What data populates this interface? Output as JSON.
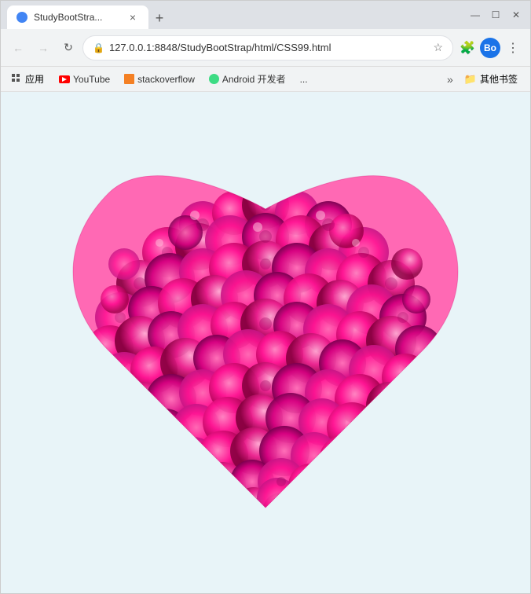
{
  "browser": {
    "tab": {
      "title": "StudyBootStra...",
      "close_label": "×",
      "favicon_alt": "page-favicon"
    },
    "new_tab_label": "+",
    "window_controls": {
      "minimize": "—",
      "maximize": "☐",
      "close": "✕"
    },
    "address_bar": {
      "back_icon": "←",
      "forward_icon": "→",
      "refresh_icon": "↻",
      "url": "127.0.0.1:8848/StudyBootStrap/html/CSS99.html",
      "lock_icon": "🔒",
      "star_icon": "☆",
      "extensions_icon": "🧩",
      "profile_label": "Bo",
      "more_icon": "⋮"
    },
    "bookmarks": {
      "apps_label": "应用",
      "items": [
        {
          "id": "youtube",
          "label": "YouTube"
        },
        {
          "id": "stackoverflow",
          "label": "stackoverflow"
        },
        {
          "id": "android",
          "label": "Android 开发者"
        },
        {
          "id": "more",
          "label": "..."
        }
      ],
      "more_icon": "»",
      "other_label": "其他书签",
      "folder_icon": "📁"
    }
  },
  "page": {
    "bg_color": "#e8f4f8",
    "heart": {
      "description": "Heart shape made of pink roses",
      "fill_color": "#ff69b4",
      "accent_color": "#ff1493"
    }
  }
}
